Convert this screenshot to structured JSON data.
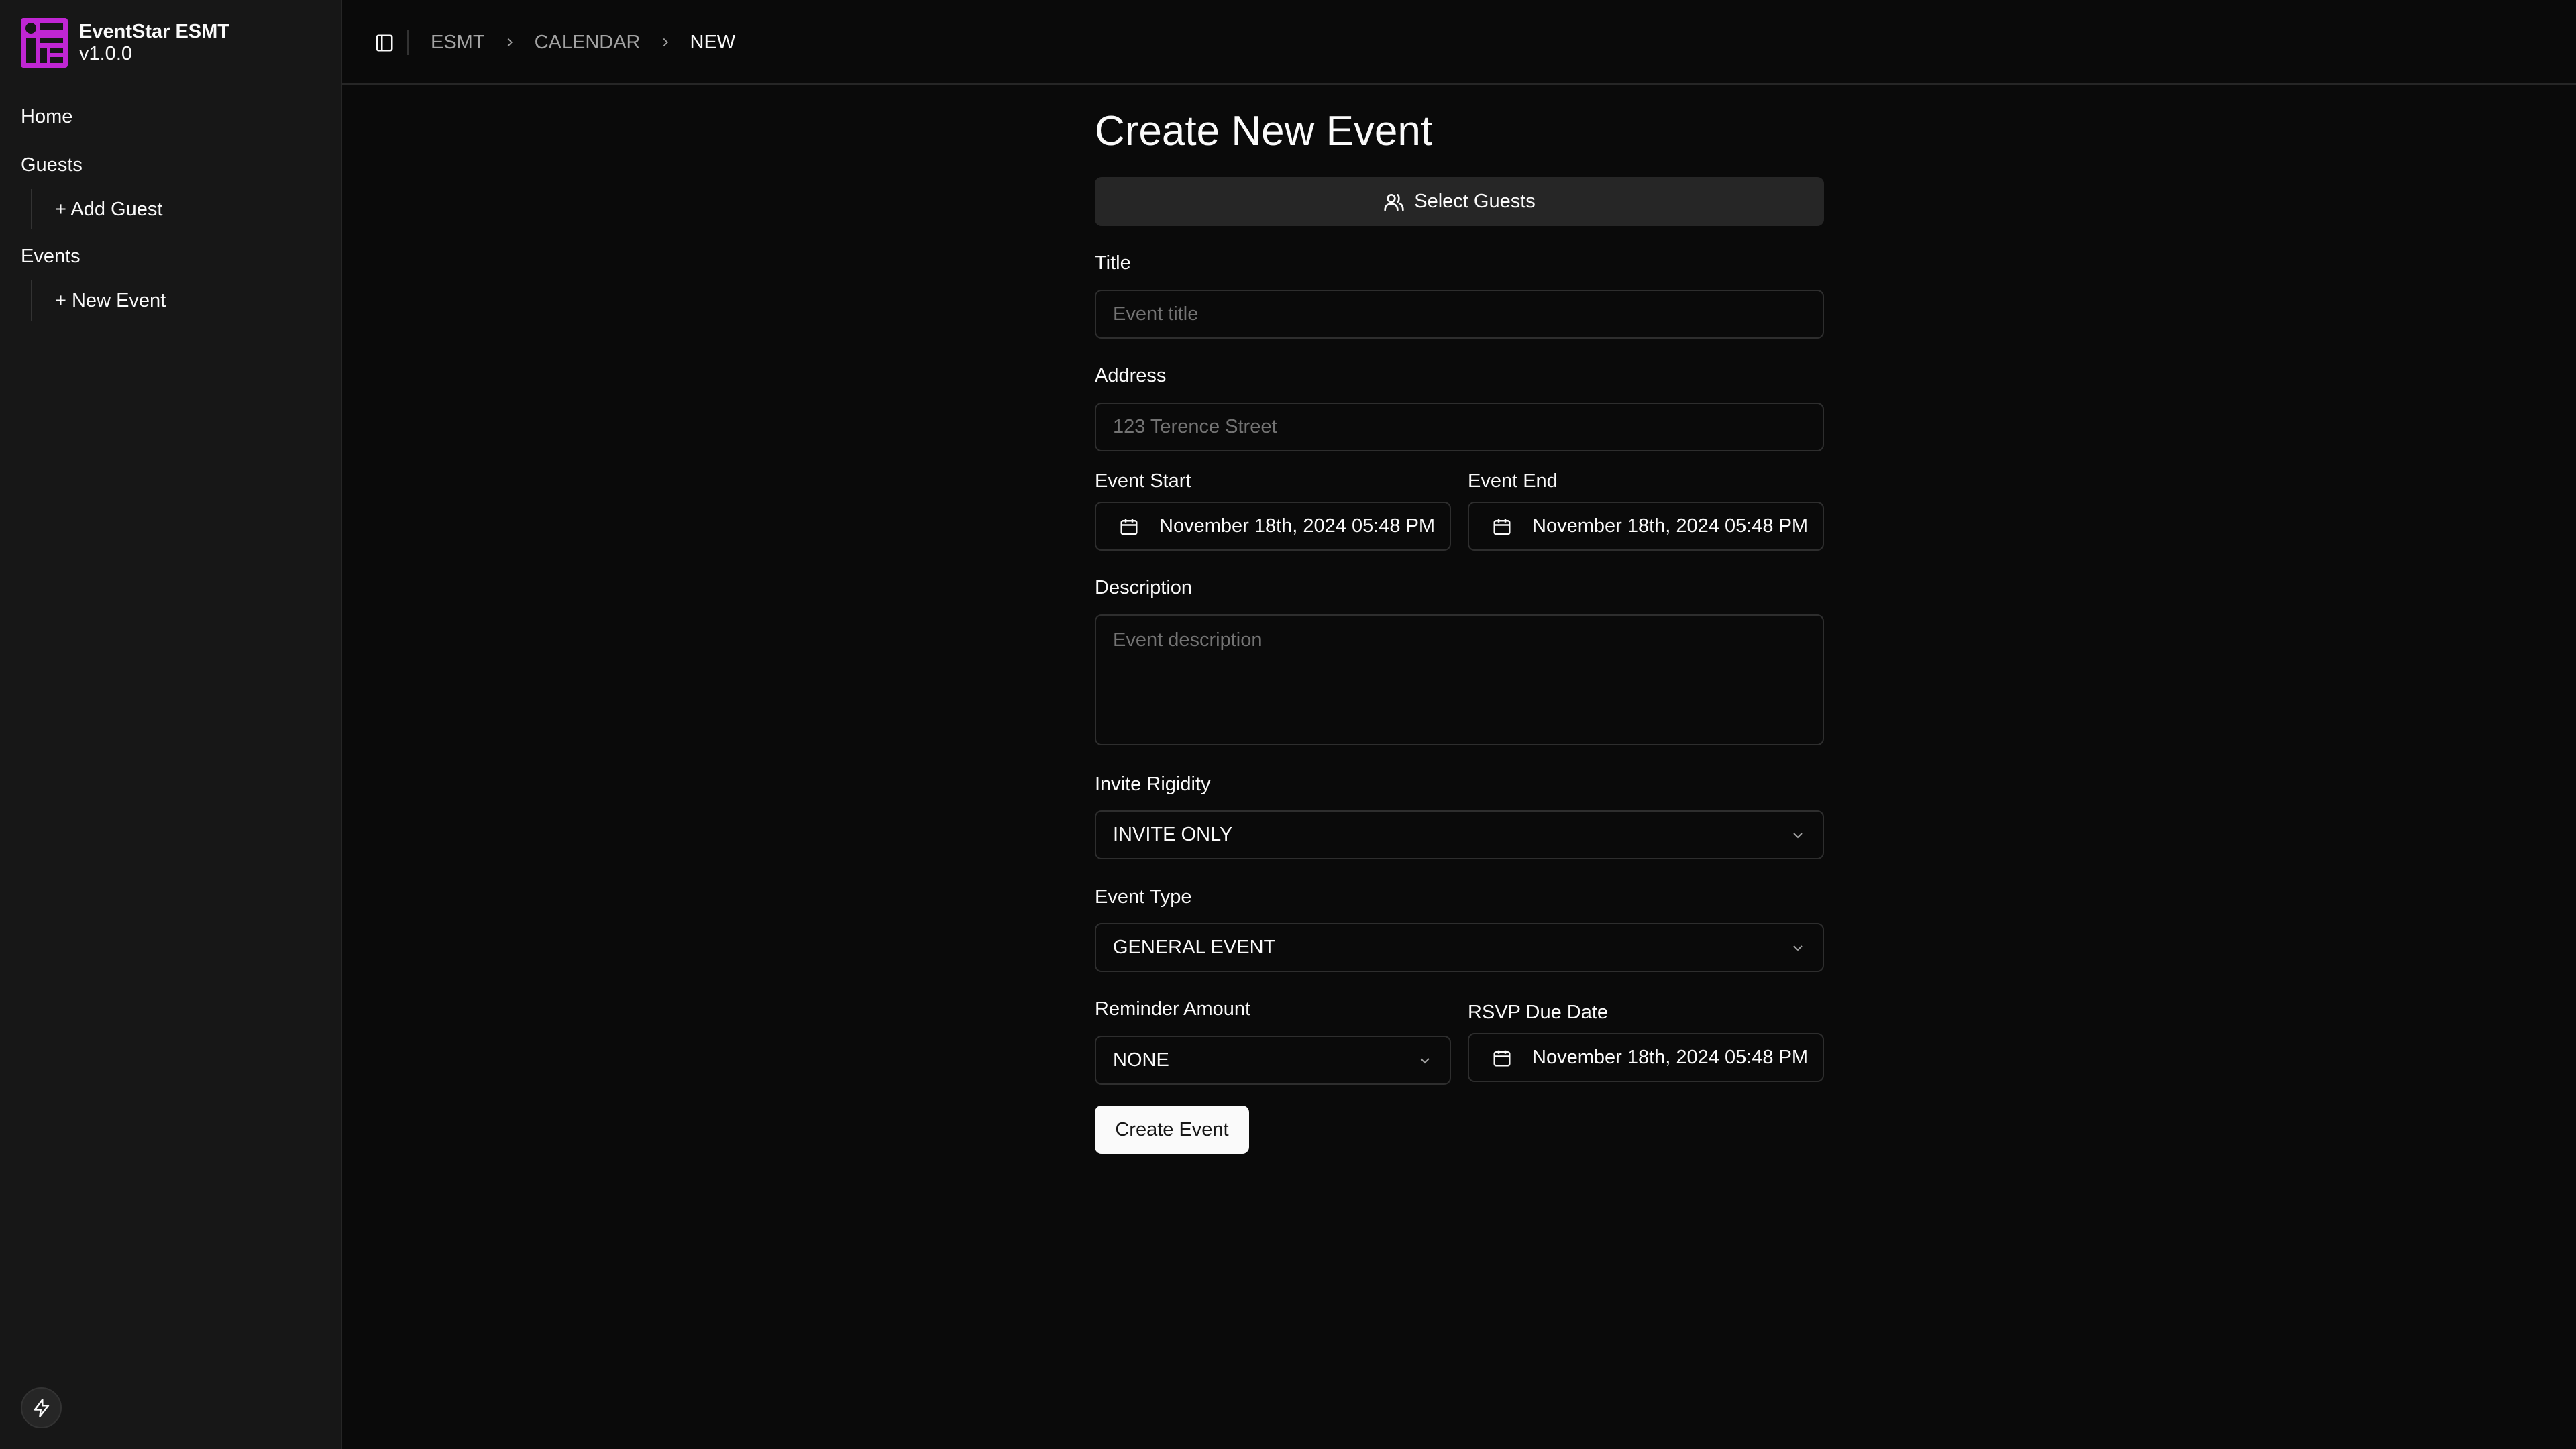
{
  "brand": {
    "name": "EventStar ESMT",
    "version": "v1.0.0",
    "accent": "#c026d3"
  },
  "sidebar": {
    "home": "Home",
    "guests": "Guests",
    "add_guest": "+ Add Guest",
    "events": "Events",
    "new_event": "+ New Event"
  },
  "breadcrumb": [
    "ESMT",
    "CALENDAR",
    "NEW"
  ],
  "form": {
    "title": "Create New Event",
    "select_guests": "Select Guests",
    "title_label": "Title",
    "title_placeholder": "Event title",
    "address_label": "Address",
    "address_placeholder": "123 Terence Street",
    "event_start_label": "Event Start",
    "event_start_value": "November 18th, 2024 05:48 PM",
    "event_end_label": "Event End",
    "event_end_value": "November 18th, 2024 05:48 PM",
    "description_label": "Description",
    "description_placeholder": "Event description",
    "invite_rigidity_label": "Invite Rigidity",
    "invite_rigidity_value": "INVITE ONLY",
    "event_type_label": "Event Type",
    "event_type_value": "GENERAL EVENT",
    "reminder_amount_label": "Reminder Amount",
    "reminder_amount_value": "NONE",
    "rsvp_due_label": "RSVP Due Date",
    "rsvp_due_value": "November 18th, 2024 05:48 PM",
    "submit": "Create Event"
  },
  "icons": {
    "logo": "eventstar-logo-icon",
    "sidebar_toggle": "sidebar-toggle-icon",
    "chevron_right": "chevron-right-icon",
    "users": "users-icon",
    "calendar": "calendar-icon",
    "chevron_down": "chevron-down-icon",
    "bolt": "bolt-icon"
  }
}
